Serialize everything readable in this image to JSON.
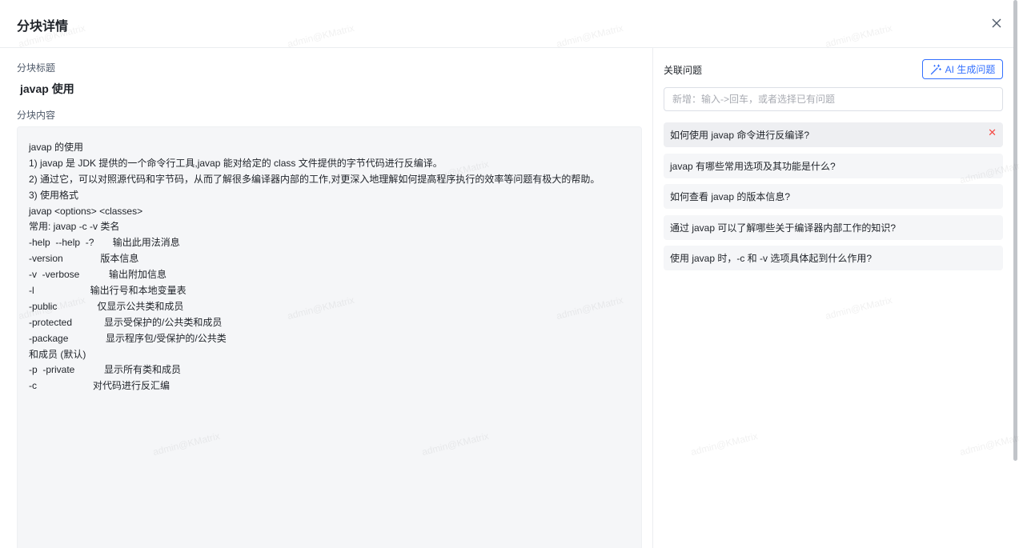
{
  "dialog": {
    "title": "分块详情",
    "close_icon": "close-icon"
  },
  "chunk": {
    "title_label": "分块标题",
    "title_value": "javap 使用",
    "content_label": "分块内容",
    "content_lines": [
      "javap 的使用",
      "1) javap 是 JDK 提供的一个命令行工具,javap 能对给定的 class 文件提供的字节代码进行反编译。",
      "2) 通过它，可以对照源代码和字节码，从而了解很多编译器内部的工作,对更深入地理解如何提高程序执行的效率等问题有极大的帮助。",
      "3) 使用格式",
      "javap <options> <classes>",
      "常用: javap -c -v 类名",
      "-help  --help  -?       输出此用法消息",
      "-version              版本信息",
      "-v  -verbose           输出附加信息",
      "-l                     输出行号和本地变量表",
      "-public               仅显示公共类和成员",
      "-protected            显示受保护的/公共类和成员",
      "-package              显示程序包/受保护的/公共类",
      "和成员 (默认)",
      "-p  -private           显示所有类和成员",
      "-c                     对代码进行反汇编"
    ]
  },
  "questions": {
    "label": "关联问题",
    "ai_button_label": "AI 生成问题",
    "ai_icon": "magic-wand-icon",
    "input_placeholder": "新增：输入->回车，或者选择已有问题",
    "input_value": "",
    "items": [
      "如何使用 javap 命令进行反编译?",
      "javap 有哪些常用选项及其功能是什么?",
      "如何查看 javap 的版本信息?",
      "通过 javap 可以了解哪些关于编译器内部工作的知识?",
      "使用 javap 时，-c 和 -v 选项具体起到什么作用?"
    ],
    "delete_icon": "delete-x-icon"
  },
  "watermark_text": "admin@KMatrix",
  "colors": {
    "accent": "#3370ff",
    "danger": "#f54a45",
    "content_bg": "#f5f6f8"
  }
}
